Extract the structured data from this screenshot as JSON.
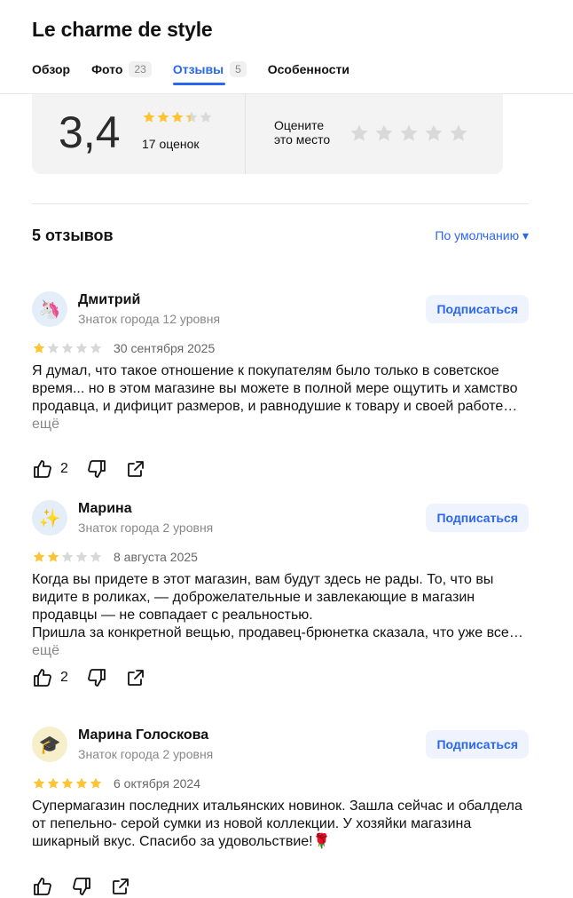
{
  "place": {
    "title": "Le charme de style",
    "tabs": [
      {
        "label": "Обзор",
        "count": ""
      },
      {
        "label": "Фото",
        "count": "23"
      },
      {
        "label": "Отзывы",
        "count": "5"
      },
      {
        "label": "Особенности",
        "count": ""
      }
    ]
  },
  "rating": {
    "value": "3,4",
    "stars": 3.4,
    "count_label": "17 оценок",
    "rate_label": "Оцените\nэто место"
  },
  "reviews_header": {
    "count_label": "5 отзывов",
    "sort_label": "По умолчанию ▾"
  },
  "colors": {
    "accent": "#2a66f0",
    "star": "#fcc434",
    "star_empty": "#d9d9d9"
  },
  "reviews": [
    {
      "author": "Дмитрий",
      "level": "Знаток города 12 уровня",
      "avatar_icon": "🦄",
      "avatar_bg": "#e3eef9",
      "stars": 1,
      "date": "30 сентября 2025",
      "text": "Я думал, что такое отношение к покупателям было только в советское время... но в этом магазине вы можете в полной мере ощутить и хамство продавца, и дифицит размеров, и равнодушие к товару и своей работе…",
      "more": "ещё",
      "likes": "2",
      "subscribe": "Подписаться"
    },
    {
      "author": "Марина",
      "level": "Знаток города 2 уровня",
      "avatar_icon": "✨",
      "avatar_bg": "#e3eef9",
      "stars": 2,
      "date": "8 августа 2025",
      "text": "Когда вы придете в этот магазин, вам будут здесь не рады. То, что вы видите в роликах, — доброжелательные и завлекающие в магазин продавцы — не совпадает с реальностью.\nПришла за конкретной вещью, продавец-брюнетка сказала, что уже все…",
      "more": "ещё",
      "likes": "2",
      "subscribe": "Подписаться"
    },
    {
      "author": "Марина Голоскова",
      "level": "Знаток города 2 уровня",
      "avatar_icon": "🎓",
      "avatar_bg": "#f7efc9",
      "stars": 5,
      "date": "6 октября 2024",
      "text": "Супермагазин последних итальянских новинок. Зашла сейчас и обалдела от пепельно- серой сумки из новой коллекции. У хозяйки магазина шикарный вкус. Спасибо за удовольствие!🌹",
      "more": "",
      "likes": "",
      "subscribe": "Подписаться"
    }
  ]
}
